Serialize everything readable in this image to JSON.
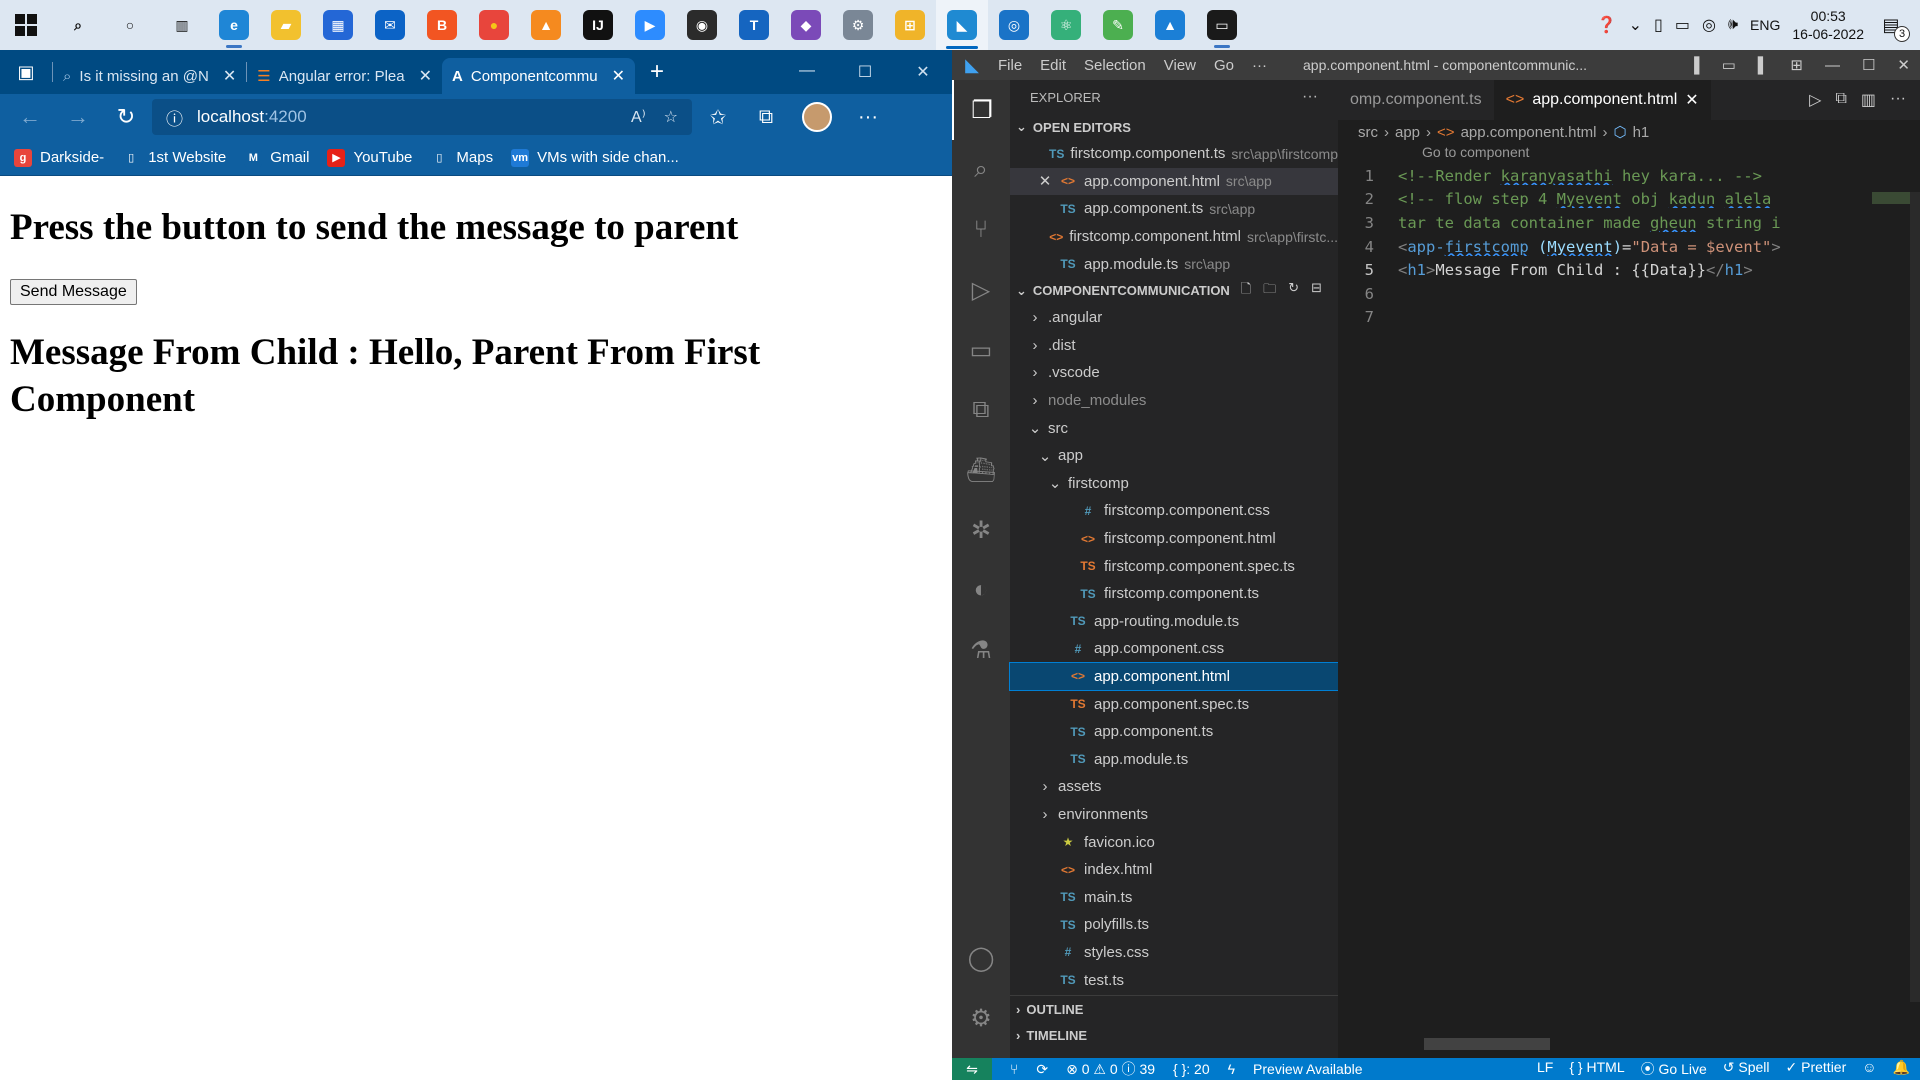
{
  "taskbar": {
    "apps": [
      {
        "name": "Search",
        "glyph": "⌕",
        "color": "#dde7f2",
        "fg": "#111"
      },
      {
        "name": "Cortana",
        "glyph": "○",
        "color": "#dde7f2",
        "fg": "#111"
      },
      {
        "name": "Task View",
        "glyph": "▥",
        "color": "#dde7f2",
        "fg": "#111"
      },
      {
        "name": "Edge",
        "glyph": "e",
        "color": "#1f86d6",
        "fg": "#fff"
      },
      {
        "name": "File Explorer",
        "glyph": "▰",
        "color": "#f2c12e",
        "fg": "#fff"
      },
      {
        "name": "Store",
        "glyph": "▦",
        "color": "#2467d6",
        "fg": "#fff"
      },
      {
        "name": "Mail",
        "glyph": "✉",
        "color": "#0b63c6",
        "fg": "#fff"
      },
      {
        "name": "Brave",
        "glyph": "B",
        "color": "#f25522",
        "fg": "#fff"
      },
      {
        "name": "Chrome",
        "glyph": "●",
        "color": "#e8453c",
        "fg": "#f5c518"
      },
      {
        "name": "VLC",
        "glyph": "▲",
        "color": "#f58a1f",
        "fg": "#fff"
      },
      {
        "name": "IntelliJ",
        "glyph": "IJ",
        "color": "#111",
        "fg": "#fff"
      },
      {
        "name": "Zoom",
        "glyph": "▶",
        "color": "#2d8cff",
        "fg": "#fff"
      },
      {
        "name": "OBS",
        "glyph": "◉",
        "color": "#2b2b2b",
        "fg": "#fff"
      },
      {
        "name": "T",
        "glyph": "T",
        "color": "#1565c0",
        "fg": "#fff"
      },
      {
        "name": "Visual Studio",
        "glyph": "◆",
        "color": "#7b4ab8",
        "fg": "#fff"
      },
      {
        "name": "Tool",
        "glyph": "⚙",
        "color": "#7a8796",
        "fg": "#fff"
      },
      {
        "name": "Network",
        "glyph": "⊞",
        "color": "#f0b429",
        "fg": "#fff"
      },
      {
        "name": "VS Code",
        "glyph": "◣",
        "color": "#1f8ad2",
        "fg": "#fff"
      },
      {
        "name": "Settings",
        "glyph": "◎",
        "color": "#1a73c7",
        "fg": "#fff"
      },
      {
        "name": "Atom",
        "glyph": "⚛",
        "color": "#35b07a",
        "fg": "#fff"
      },
      {
        "name": "Paint",
        "glyph": "✎",
        "color": "#4caf50",
        "fg": "#fff"
      },
      {
        "name": "Photos",
        "glyph": "▲",
        "color": "#1b7fd6",
        "fg": "#fff"
      },
      {
        "name": "Terminal",
        "glyph": "▭",
        "color": "#1a1a1a",
        "fg": "#fff"
      }
    ],
    "language": "ENG",
    "time": "00:53",
    "date": "16-06-2022",
    "notification_count": "3"
  },
  "browser": {
    "tabs": [
      {
        "title": "Is it missing an @N"
      },
      {
        "title": "Angular error: Plea"
      },
      {
        "title": "Componentcommu"
      }
    ],
    "url_host": "localhost",
    "url_port": ":4200",
    "bookmarks": [
      {
        "label": "Darkside-",
        "icon_color": "#e8453c",
        "glyph": "g"
      },
      {
        "label": "1st Website",
        "icon_color": "#0f5fa0",
        "glyph": "▯"
      },
      {
        "label": "Gmail",
        "icon_color": "#0f5fa0",
        "glyph": "M"
      },
      {
        "label": "YouTube",
        "icon_color": "#e62117",
        "glyph": "▶"
      },
      {
        "label": "Maps",
        "icon_color": "#0f5fa0",
        "glyph": "▯"
      },
      {
        "label": "VMs with side chan...",
        "icon_color": "#1e7ad6",
        "glyph": "vm"
      }
    ],
    "page": {
      "heading": "Press the button to send the message to parent",
      "button": "Send Message",
      "message": "Message From Child : Hello, Parent From First Component"
    }
  },
  "vscode": {
    "menu": [
      "File",
      "Edit",
      "Selection",
      "View",
      "Go",
      "···"
    ],
    "window_title": "app.component.html - componentcommunic...",
    "explorer_title": "EXPLORER",
    "open_editors_title": "OPEN EDITORS",
    "open_editors": [
      {
        "icon": "TS",
        "kind": "ts",
        "name": "firstcomp.component.ts",
        "path": "src\\app\\firstcomp",
        "close": ""
      },
      {
        "icon": "<>",
        "kind": "htm",
        "name": "app.component.html",
        "path": "src\\app",
        "close": "✕"
      },
      {
        "icon": "TS",
        "kind": "ts",
        "name": "app.component.ts",
        "path": "src\\app",
        "close": ""
      },
      {
        "icon": "<>",
        "kind": "htm",
        "name": "firstcomp.component.html",
        "path": "src\\app\\firstc...",
        "close": ""
      },
      {
        "icon": "TS",
        "kind": "ts",
        "name": "app.module.ts",
        "path": "src\\app",
        "close": ""
      }
    ],
    "project_title": "COMPONENTCOMMUNICATION",
    "tree": [
      {
        "depth": 0,
        "chev": "›",
        "icon": "",
        "kind": "",
        "name": ".angular"
      },
      {
        "depth": 0,
        "chev": "›",
        "icon": "",
        "kind": "",
        "name": ".dist"
      },
      {
        "depth": 0,
        "chev": "›",
        "icon": "",
        "kind": "",
        "name": ".vscode"
      },
      {
        "depth": 0,
        "chev": "›",
        "icon": "",
        "kind": "dim",
        "name": "node_modules"
      },
      {
        "depth": 0,
        "chev": "⌄",
        "icon": "",
        "kind": "",
        "name": "src"
      },
      {
        "depth": 1,
        "chev": "⌄",
        "icon": "",
        "kind": "",
        "name": "app"
      },
      {
        "depth": 2,
        "chev": "⌄",
        "icon": "",
        "kind": "",
        "name": "firstcomp"
      },
      {
        "depth": 3,
        "chev": "",
        "icon": "#",
        "kind": "css",
        "name": "firstcomp.component.css"
      },
      {
        "depth": 3,
        "chev": "",
        "icon": "<>",
        "kind": "htm",
        "name": "firstcomp.component.html"
      },
      {
        "depth": 3,
        "chev": "",
        "icon": "TS",
        "kind": "spec",
        "name": "firstcomp.component.spec.ts"
      },
      {
        "depth": 3,
        "chev": "",
        "icon": "TS",
        "kind": "ts",
        "name": "firstcomp.component.ts"
      },
      {
        "depth": 2,
        "chev": "",
        "icon": "TS",
        "kind": "ts",
        "name": "app-routing.module.ts"
      },
      {
        "depth": 2,
        "chev": "",
        "icon": "#",
        "kind": "css",
        "name": "app.component.css"
      },
      {
        "depth": 2,
        "chev": "",
        "icon": "<>",
        "kind": "htm",
        "name": "app.component.html",
        "selected": true
      },
      {
        "depth": 2,
        "chev": "",
        "icon": "TS",
        "kind": "spec",
        "name": "app.component.spec.ts"
      },
      {
        "depth": 2,
        "chev": "",
        "icon": "TS",
        "kind": "ts",
        "name": "app.component.ts"
      },
      {
        "depth": 2,
        "chev": "",
        "icon": "TS",
        "kind": "ts",
        "name": "app.module.ts"
      },
      {
        "depth": 1,
        "chev": "›",
        "icon": "",
        "kind": "",
        "name": "assets"
      },
      {
        "depth": 1,
        "chev": "›",
        "icon": "",
        "kind": "",
        "name": "environments"
      },
      {
        "depth": 1,
        "chev": "",
        "icon": "★",
        "kind": "star",
        "name": "favicon.ico"
      },
      {
        "depth": 1,
        "chev": "",
        "icon": "<>",
        "kind": "htm",
        "name": "index.html"
      },
      {
        "depth": 1,
        "chev": "",
        "icon": "TS",
        "kind": "ts",
        "name": "main.ts"
      },
      {
        "depth": 1,
        "chev": "",
        "icon": "TS",
        "kind": "ts",
        "name": "polyfills.ts"
      },
      {
        "depth": 1,
        "chev": "",
        "icon": "#",
        "kind": "css",
        "name": "styles.css"
      },
      {
        "depth": 1,
        "chev": "",
        "icon": "TS",
        "kind": "ts",
        "name": "test.ts"
      }
    ],
    "outline_title": "OUTLINE",
    "timeline_title": "TIMELINE",
    "editor_tabs": [
      {
        "label": "omp.component.ts",
        "active": false
      },
      {
        "label": "app.component.html",
        "active": true
      }
    ],
    "breadcrumb": [
      "src",
      "app",
      "app.component.html",
      "h1"
    ],
    "goto_hint": "Go to component",
    "code_lines": [
      {
        "n": "1",
        "html": "<span class=\"cm\">&lt;!--Render <span class=\"sq\">karanyasathi</span> hey kara... --&gt;</span>"
      },
      {
        "n": "2",
        "html": "<span class=\"cm\">&lt;!-- flow step 4 <span class=\"sq\">Myevent</span> obj <span class=\"sq\">kadun</span> <span class=\"sq\">alela</span></span>"
      },
      {
        "n": "3",
        "html": "<span class=\"cm\">tar te data container made <span class=\"sq\">gheun</span> string i</span>"
      },
      {
        "n": "4",
        "html": "<span class=\"br\">&lt;</span><span class=\"tg\">app-<span class=\"sq\">firstcomp</span></span> <span class=\"at\">(<span class=\"sq\">Myevent</span>)</span><span class=\"tx\">=</span><span class=\"st\">\"Data = $event\"</span><span class=\"br\">&gt;</span>"
      },
      {
        "n": "5",
        "html": "<span class=\"br\">&lt;</span><span class=\"tg\">h1</span><span class=\"br\">&gt;</span><span class=\"tx\">Message From Child : {{Data}}</span><span class=\"br\">&lt;/</span><span class=\"tg\">h1</span><span class=\"br\">&gt;</span>"
      },
      {
        "n": "6",
        "html": ""
      },
      {
        "n": "7",
        "html": ""
      }
    ],
    "status": {
      "problems": "⊗ 0 ⚠ 0 ⓘ 39",
      "braces": "{ }: 20",
      "preview": "Preview Available",
      "eol": "LF",
      "language": "{ } HTML",
      "golive": "Go Live",
      "spell": "Spell",
      "prettier": "✓ Prettier"
    }
  }
}
